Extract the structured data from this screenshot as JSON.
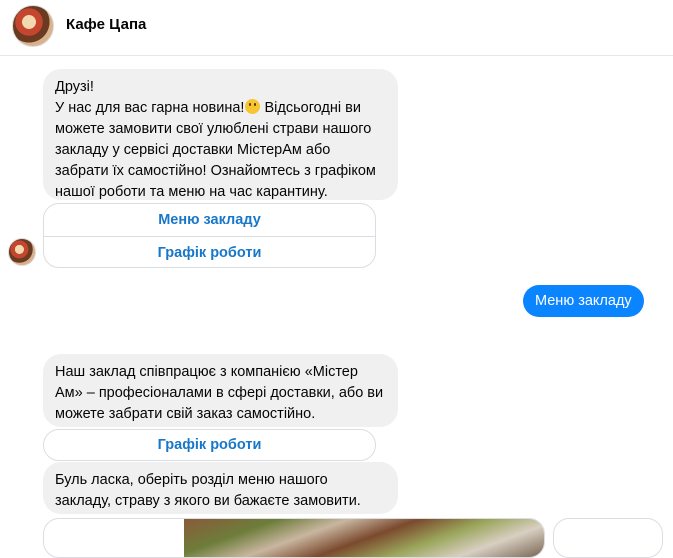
{
  "header": {
    "title": "Кафе Цапа"
  },
  "messages": {
    "m1": {
      "lines": [
        "Друзі!",
        "У нас для вас гарна новина!",
        " Відсьогодні ви",
        "можете замовити свої улюблені страви нашого",
        "закладу у сервісі доставки МістерАм або",
        "забрати їх самостійно! Ознайомтесь з графіком",
        "нашої роботи та меню на час карантину."
      ],
      "emoji": "smiling-face-icon"
    },
    "m1_buttons": {
      "menu": "Меню закладу",
      "schedule": "Графік роботи"
    },
    "user_reply": "Меню закладу",
    "m2": {
      "lines": [
        "Наш заклад співпрацює з компанією «Містер",
        "Ам» – професіоналами в сфері доставки, або ви",
        "можете забрати свій заказ самостійно."
      ]
    },
    "m2_buttons": {
      "schedule": "Графік роботи"
    },
    "m3": {
      "lines": [
        "Буль ласка, оберіть розділ меню нашого",
        "закладу, страву з якого ви бажаєте замовити."
      ]
    }
  },
  "colors": {
    "accent": "#0a84ff",
    "button_text": "#1877c9",
    "bubble_in": "#f0f0f0"
  }
}
